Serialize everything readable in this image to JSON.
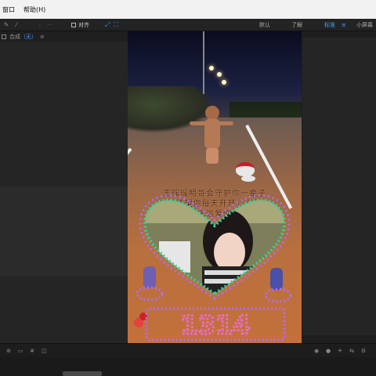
{
  "menu": {
    "items": [
      "窗口",
      "帮助(H)"
    ]
  },
  "toolbar": {
    "snap_label": "对齐",
    "workspaces": [
      "默认",
      "了解",
      "标准",
      "小屏幕"
    ],
    "active_workspace": "标准"
  },
  "comp_panel": {
    "title": "合成",
    "comp_name": "（无）"
  },
  "video": {
    "lyric_lines": [
      "王瑶瑶明哥会守护你一辈子",
      "世希望你每天开开心心的",
      "永远爱你"
    ],
    "number_display": "1314",
    "colors": {
      "frame_lights": "#2ad6a6",
      "number_lights": "#b06cff",
      "accent": "#e64040"
    }
  },
  "colors": {
    "menubar": "#f2f2f2",
    "panel": "#252525",
    "accent_blue": "#3f95ff"
  }
}
